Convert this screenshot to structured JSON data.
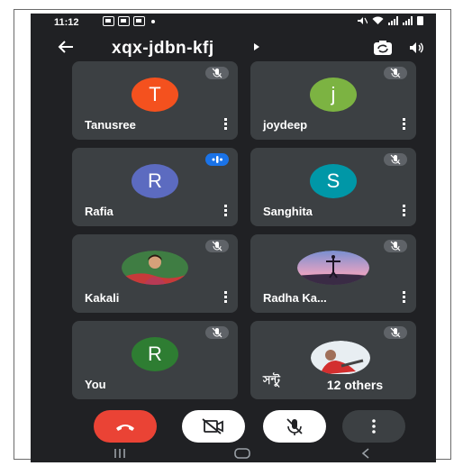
{
  "status_bar": {
    "time": "11:12",
    "icons": [
      "photo-notification-icon",
      "gallery-notification-icon",
      "message-notification-icon",
      "dot-icon",
      "mute-icon",
      "wifi-icon",
      "signal-icon",
      "battery-icon"
    ]
  },
  "header": {
    "meeting_code": "xqx-jdbn-kfj",
    "back_icon": "arrow-left-icon",
    "switch_camera_icon": "switch-camera-icon",
    "audio_output_icon": "speaker-icon"
  },
  "participants": [
    {
      "name": "Tanusree",
      "avatar_letter": "T",
      "avatar_color": "#f4511e",
      "muted": true
    },
    {
      "name": "joydeep",
      "avatar_letter": "j",
      "avatar_color": "#7cb342",
      "muted": true
    },
    {
      "name": "Rafia",
      "avatar_letter": "R",
      "avatar_color": "#5c6bc0",
      "muted": false,
      "speaking": true
    },
    {
      "name": "Sanghita",
      "avatar_letter": "S",
      "avatar_color": "#0097a7",
      "muted": true
    },
    {
      "name": "Kakali",
      "avatar_photo": true,
      "muted": true
    },
    {
      "name": "Radha Ka...",
      "avatar_photo": true,
      "muted": true
    },
    {
      "name": "You",
      "avatar_letter": "R",
      "avatar_color": "#2e7d32",
      "muted": true
    },
    {
      "name": "সন্টু",
      "avatar_photo": true,
      "muted": true,
      "others_label": "12 others"
    }
  ],
  "controls": {
    "end_call_icon": "end-call-icon",
    "camera_icon": "camera-off-icon",
    "mic_icon": "mic-off-icon",
    "more_icon": "more-vert-icon",
    "end_call_color": "#ea4335"
  },
  "nav_bar": {
    "icons": [
      "recents-icon",
      "home-icon",
      "back-icon"
    ]
  }
}
